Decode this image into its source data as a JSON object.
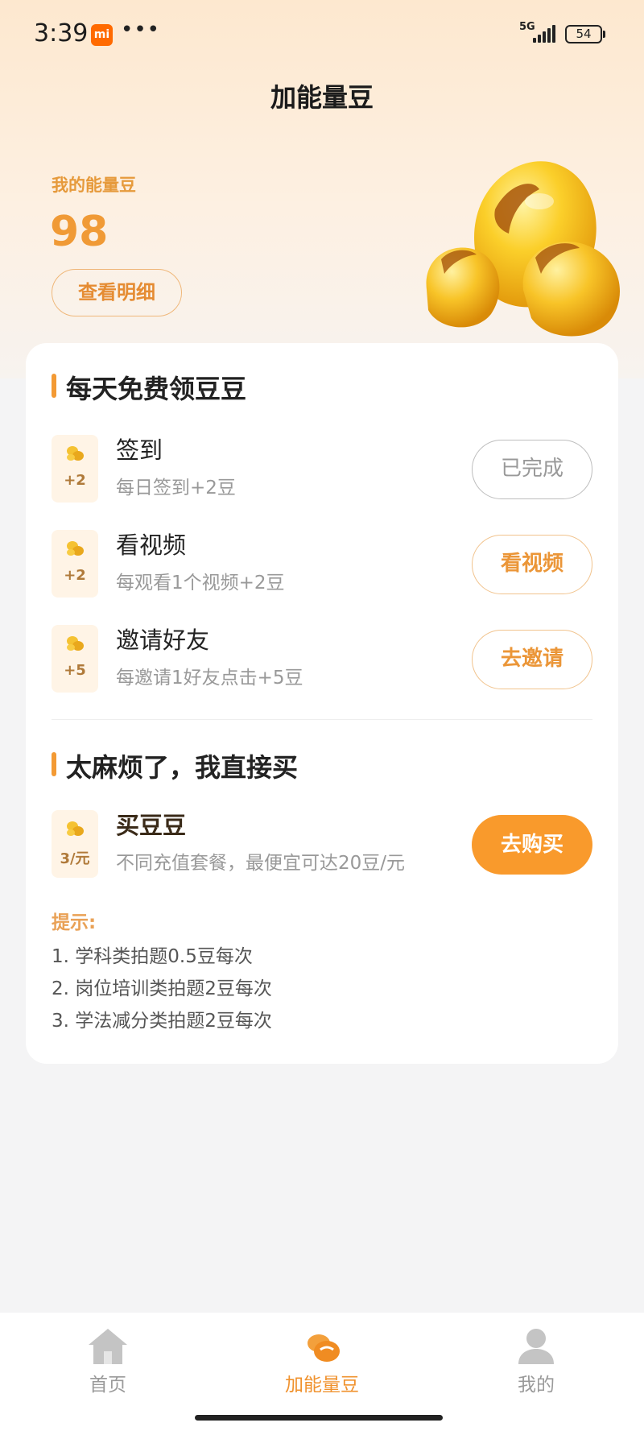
{
  "status_bar": {
    "time": "3:39",
    "app_badge": "mi",
    "dots": "•••",
    "network": "5G",
    "battery": "54"
  },
  "page": {
    "title": "加能量豆"
  },
  "balance": {
    "label": "我的能量豆",
    "value": "98",
    "detail_button": "查看明细"
  },
  "free_section": {
    "title": "每天免费领豆豆",
    "tasks": [
      {
        "name": "签到",
        "desc": "每日签到+2豆",
        "reward": "+2",
        "button": "已完成",
        "status": "done"
      },
      {
        "name": "看视频",
        "desc": "每观看1个视频+2豆",
        "reward": "+2",
        "button": "看视频",
        "status": "active"
      },
      {
        "name": "邀请好友",
        "desc": "每邀请1好友点击+5豆",
        "reward": "+5",
        "button": "去邀请",
        "status": "active"
      }
    ]
  },
  "buy_section": {
    "title": "太麻烦了，我直接买",
    "item": {
      "name": "买豆豆",
      "desc": "不同充值套餐，最便宜可达20豆/元",
      "price": "3/元",
      "button": "去购买"
    }
  },
  "tips": {
    "title": "提示:",
    "lines": [
      "1. 学科类拍题0.5豆每次",
      "2. 岗位培训类拍题2豆每次",
      "3. 学法减分类拍题2豆每次"
    ]
  },
  "bottom_nav": {
    "items": [
      {
        "label": "首页",
        "icon": "home-icon"
      },
      {
        "label": "加能量豆",
        "icon": "beans-icon",
        "active": true
      },
      {
        "label": "我的",
        "icon": "user-icon"
      }
    ]
  },
  "colors": {
    "accent": "#f99a2c",
    "accent_text": "#eb9638",
    "bg": "#f4f4f5"
  }
}
